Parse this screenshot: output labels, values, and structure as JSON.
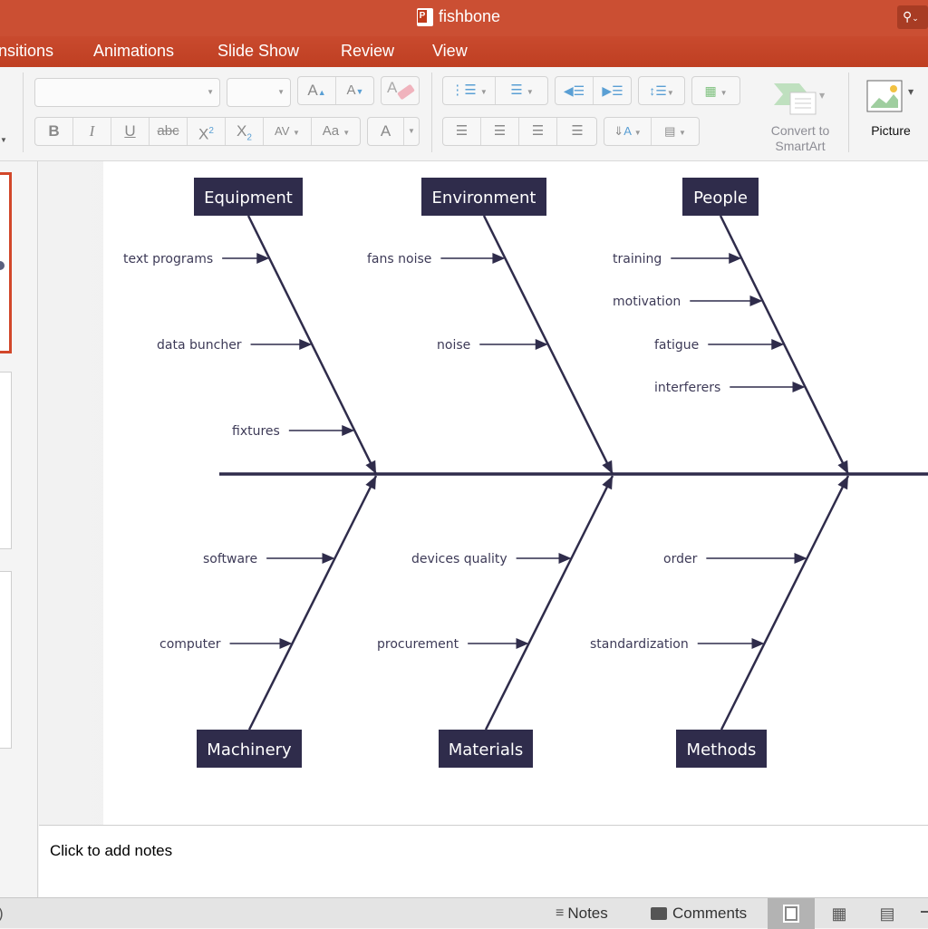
{
  "window": {
    "title": "fishbone",
    "search_icon": "search-icon"
  },
  "tabs": [
    {
      "label": "nsitions"
    },
    {
      "label": "Animations"
    },
    {
      "label": "Slide Show"
    },
    {
      "label": "Review"
    },
    {
      "label": "View"
    }
  ],
  "ribbon": {
    "font_name_value": "",
    "font_size_value": "",
    "increase_font": "A",
    "decrease_font": "A",
    "bold": "B",
    "italic": "I",
    "underline": "U",
    "strikethrough": "abc",
    "superscript": "X",
    "subscript": "X",
    "char_spacing": "AV",
    "change_case": "Aa",
    "font_color": "A",
    "convert_smartart_label": "Convert to SmartArt",
    "picture_label": "Picture"
  },
  "diagram": {
    "colors": {
      "dark": "#2f2c4b",
      "text": "#3d3a57",
      "box_text": "#ffffff"
    },
    "categories_top": [
      {
        "label": "Equipment",
        "causes": [
          "text programs",
          "data buncher",
          "fixtures"
        ]
      },
      {
        "label": "Environment",
        "causes": [
          "fans noise",
          "noise"
        ]
      },
      {
        "label": "People",
        "causes": [
          "training",
          "motivation",
          "fatigue",
          "interferers"
        ]
      }
    ],
    "categories_bottom": [
      {
        "label": "Machinery",
        "causes": [
          "software",
          "computer"
        ]
      },
      {
        "label": "Materials",
        "causes": [
          "devices quality",
          "procurement"
        ]
      },
      {
        "label": "Methods",
        "causes": [
          "order",
          "standardization"
        ]
      }
    ]
  },
  "notes": {
    "placeholder": "Click to add notes"
  },
  "statusbar": {
    "left_fragment": ")",
    "notes_label": "Notes",
    "comments_label": "Comments"
  },
  "accent_color": "#cb4f33"
}
